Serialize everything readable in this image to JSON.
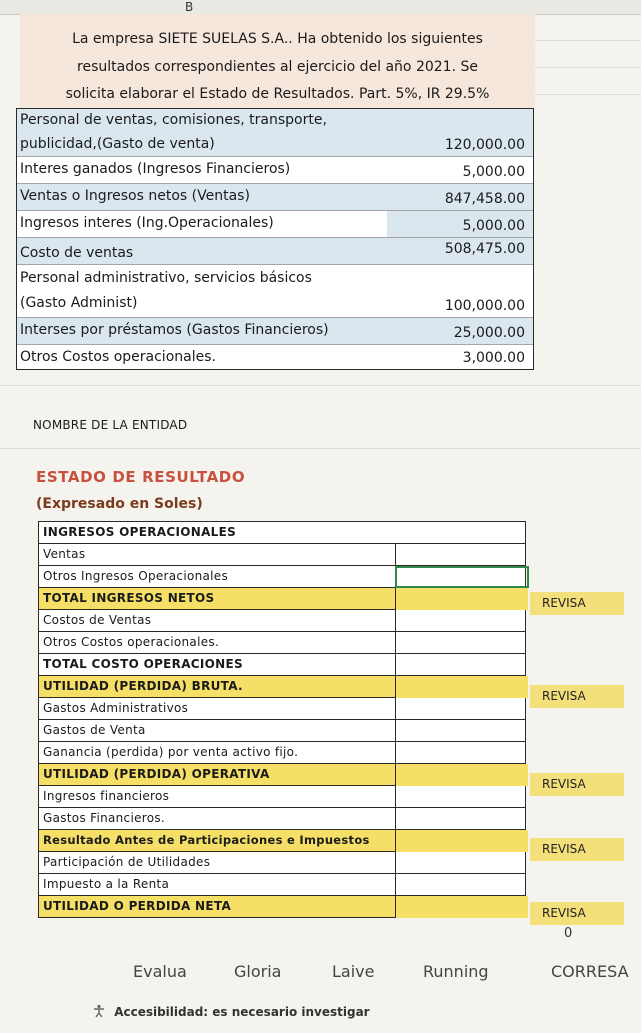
{
  "column_header": "B",
  "intro": {
    "line1": "La empresa SIETE SUELAS S.A.. Ha obtenido los siguientes",
    "line2": "resultados correspondientes al ejercicio del año 2021. Se",
    "line3": "solicita elaborar el Estado de Resultados. Part. 5%, IR 29.5%"
  },
  "data_table": [
    {
      "label1": "Personal de ventas, comisiones, transporte,",
      "label2": "publicidad,(Gasto de venta)",
      "value": "120,000.00"
    },
    {
      "label1": "Interes ganados (Ingresos Financieros)",
      "value": "5,000.00"
    },
    {
      "label1": "Ventas o Ingresos netos (Ventas)",
      "value": "847,458.00"
    },
    {
      "label1": "Ingresos interes (Ing.Operacionales)",
      "value": "5,000.00"
    },
    {
      "label1": "Costo de ventas",
      "value": "508,475.00"
    },
    {
      "label1": "Personal administrativo, servicios básicos",
      "label2": "(Gasto Administ)",
      "value": "100,000.00"
    },
    {
      "label1": "Interses por préstamos  (Gastos Financieros)",
      "value": "25,000.00"
    },
    {
      "label1": "Otros Costos operacionales.",
      "value": "3,000.00"
    }
  ],
  "entity_name": "NOMBRE DE LA ENTIDAD",
  "statement_title": "ESTADO DE RESULTADO",
  "statement_subtitle": "(Expresado en  Soles)",
  "statement_rows": [
    "INGRESOS OPERACIONALES",
    "Ventas",
    "Otros Ingresos Operacionales",
    "TOTAL INGRESOS NETOS",
    "Costos de Ventas",
    "Otros Costos operacionales.",
    "TOTAL COSTO OPERACIONES",
    "UTILIDAD (PERDIDA) BRUTA.",
    "Gastos Administrativos",
    "Gastos de Venta",
    "Ganancia (perdida) por venta activo fijo.",
    "UTILIDAD (PERDIDA) OPERATIVA",
    "Ingresos financieros",
    "Gastos Financieros.",
    "Resultado Antes de Participaciones e Impuestos",
    "Participación de Utilidades",
    "Impuesto a la Renta",
    "UTILIDAD O PERDIDA NETA"
  ],
  "revisa_label": "REVISA",
  "zero_value": "0",
  "sheet_tabs": [
    "Evalua",
    "Gloria",
    "Laive",
    "Running",
    "CORRESA"
  ],
  "status_bar": "Accesibilidad: es necesario investigar"
}
